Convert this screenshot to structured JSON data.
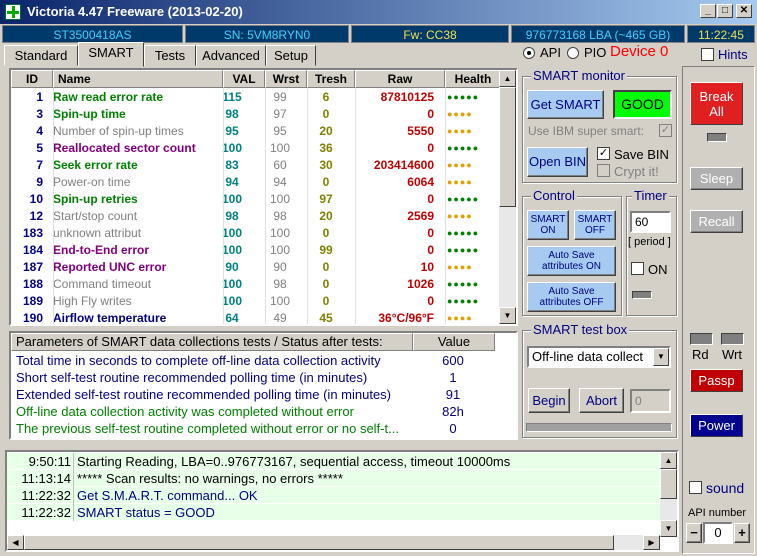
{
  "window": {
    "title": "Victoria 4.47 Freeware (2013-02-20)",
    "controls": {
      "minimize": "_",
      "maximize": "□",
      "close": "✕"
    }
  },
  "drive_info": {
    "model": "ST3500418AS",
    "serial": "SN: 5VM8RYN0",
    "firmware": "Fw: CC38",
    "capacity": "976773168 LBA (~465 GB)",
    "clock": "11:22:45"
  },
  "tabs": [
    "Standard",
    "SMART",
    "Tests",
    "Advanced",
    "Setup"
  ],
  "active_tab": "SMART",
  "mode": {
    "api_label": "API",
    "pio_label": "PIO",
    "device_label": "Device 0",
    "hints_label": "Hints"
  },
  "smart_table": {
    "headers": [
      "ID",
      "Name",
      "VAL",
      "Wrst",
      "Tresh",
      "Raw",
      "Health"
    ],
    "rows": [
      {
        "id": "1",
        "name": "Raw read error rate",
        "val": "115",
        "wrst": "99",
        "tresh": "6",
        "raw": "87810125",
        "health": "●●●●●",
        "name_color": "#008000",
        "health_color": "#008000"
      },
      {
        "id": "3",
        "name": "Spin-up time",
        "val": "98",
        "wrst": "97",
        "tresh": "0",
        "raw": "0",
        "health": "●●●●",
        "name_color": "#008000",
        "health_color": "#e0a000"
      },
      {
        "id": "4",
        "name": "Number of spin-up times",
        "val": "95",
        "wrst": "95",
        "tresh": "20",
        "raw": "5550",
        "health": "●●●●",
        "name_color": "#808080",
        "health_color": "#e0a000"
      },
      {
        "id": "5",
        "name": "Reallocated sector count",
        "val": "100",
        "wrst": "100",
        "tresh": "36",
        "raw": "0",
        "health": "●●●●●",
        "name_color": "#800080",
        "health_color": "#008000"
      },
      {
        "id": "7",
        "name": "Seek error rate",
        "val": "83",
        "wrst": "60",
        "tresh": "30",
        "raw": "203414600",
        "health": "●●●●",
        "name_color": "#008000",
        "health_color": "#e0a000"
      },
      {
        "id": "9",
        "name": "Power-on time",
        "val": "94",
        "wrst": "94",
        "tresh": "0",
        "raw": "6064",
        "health": "●●●●",
        "name_color": "#808080",
        "health_color": "#e0a000"
      },
      {
        "id": "10",
        "name": "Spin-up retries",
        "val": "100",
        "wrst": "100",
        "tresh": "97",
        "raw": "0",
        "health": "●●●●●",
        "name_color": "#008000",
        "health_color": "#008000"
      },
      {
        "id": "12",
        "name": "Start/stop count",
        "val": "98",
        "wrst": "98",
        "tresh": "20",
        "raw": "2569",
        "health": "●●●●",
        "name_color": "#808080",
        "health_color": "#e0a000"
      },
      {
        "id": "183",
        "name": "unknown attribut",
        "val": "100",
        "wrst": "100",
        "tresh": "0",
        "raw": "0",
        "health": "●●●●●",
        "name_color": "#808080",
        "health_color": "#008000"
      },
      {
        "id": "184",
        "name": "End-to-End error",
        "val": "100",
        "wrst": "100",
        "tresh": "99",
        "raw": "0",
        "health": "●●●●●",
        "name_color": "#800080",
        "health_color": "#008000"
      },
      {
        "id": "187",
        "name": "Reported UNC error",
        "val": "90",
        "wrst": "90",
        "tresh": "0",
        "raw": "10",
        "health": "●●●●",
        "name_color": "#800080",
        "health_color": "#e0a000"
      },
      {
        "id": "188",
        "name": "Command timeout",
        "val": "100",
        "wrst": "98",
        "tresh": "0",
        "raw": "1026",
        "health": "●●●●●",
        "name_color": "#808080",
        "health_color": "#008000"
      },
      {
        "id": "189",
        "name": "High Fly writes",
        "val": "100",
        "wrst": "100",
        "tresh": "0",
        "raw": "0",
        "health": "●●●●●",
        "name_color": "#808080",
        "health_color": "#008000"
      },
      {
        "id": "190",
        "name": "Airflow temperature",
        "val": "64",
        "wrst": "49",
        "tresh": "45",
        "raw": "36°C/96°F",
        "health": "●●●●",
        "name_color": "#000080",
        "health_color": "#e0a000"
      }
    ]
  },
  "params_table": {
    "headers": [
      "Parameters of SMART data collections tests / Status after tests:",
      "Value"
    ],
    "rows": [
      {
        "name": "Total time in seconds to complete off-line data collection activity",
        "value": "600",
        "color": "#000080"
      },
      {
        "name": "Short self-test routine recommended polling time (in minutes)",
        "value": "1",
        "color": "#000080"
      },
      {
        "name": "Extended self-test routine recommended polling time (in minutes)",
        "value": "91",
        "color": "#000080"
      },
      {
        "name": "Off-line data collection activity was completed without error",
        "value": "82h",
        "color": "#008000"
      },
      {
        "name": "The previous self-test routine completed without error or no self-t...",
        "value": "0",
        "color": "#008000"
      }
    ]
  },
  "smart_monitor": {
    "title": "SMART monitor",
    "get_smart": "Get SMART",
    "status": "GOOD",
    "ibm_label": "Use IBM super smart:",
    "open_bin": "Open BIN",
    "save_bin": "Save BIN",
    "crypt": "Crypt it!"
  },
  "control": {
    "title": "Control",
    "smart_on": "SMART ON",
    "smart_off": "SMART OFF",
    "autosave_on": "Auto Save attributes ON",
    "autosave_off": "Auto Save attributes OFF"
  },
  "timer": {
    "title": "Timer",
    "value": "60",
    "period_label": "[ period ]",
    "on_label": "ON"
  },
  "test_box": {
    "title": "SMART test box",
    "selected": "Off-line data collect",
    "begin": "Begin",
    "abort": "Abort",
    "value": "0"
  },
  "side": {
    "break_all": "Break All",
    "sleep": "Sleep",
    "recall": "Recall",
    "rd": "Rd",
    "wrt": "Wrt",
    "passp": "Passp",
    "power": "Power",
    "sound": "sound",
    "api_number_label": "API number",
    "api_number": "0",
    "minus": "−",
    "plus": "+"
  },
  "log": [
    {
      "time": "9:50:11",
      "msg": "Starting Reading, LBA=0..976773167, sequential access, timeout 10000ms",
      "color": "#000000"
    },
    {
      "time": "11:13:14",
      "msg": "***** Scan results: no warnings, no errors *****",
      "color": "#000000"
    },
    {
      "time": "11:22:32",
      "msg": "Get S.M.A.R.T. command... OK",
      "color": "#000080"
    },
    {
      "time": "11:22:32",
      "msg": "SMART status = GOOD",
      "color": "#000080"
    }
  ],
  "colors": {
    "title_gradient_start": "#0a246a",
    "info_bg": "#003a6a",
    "info_text": "#40d0ff",
    "device_red": "#ff0000",
    "good_green": "#00ff00",
    "break_red": "#e02020",
    "passp_red": "#c00000",
    "power_blue": "#000090"
  }
}
